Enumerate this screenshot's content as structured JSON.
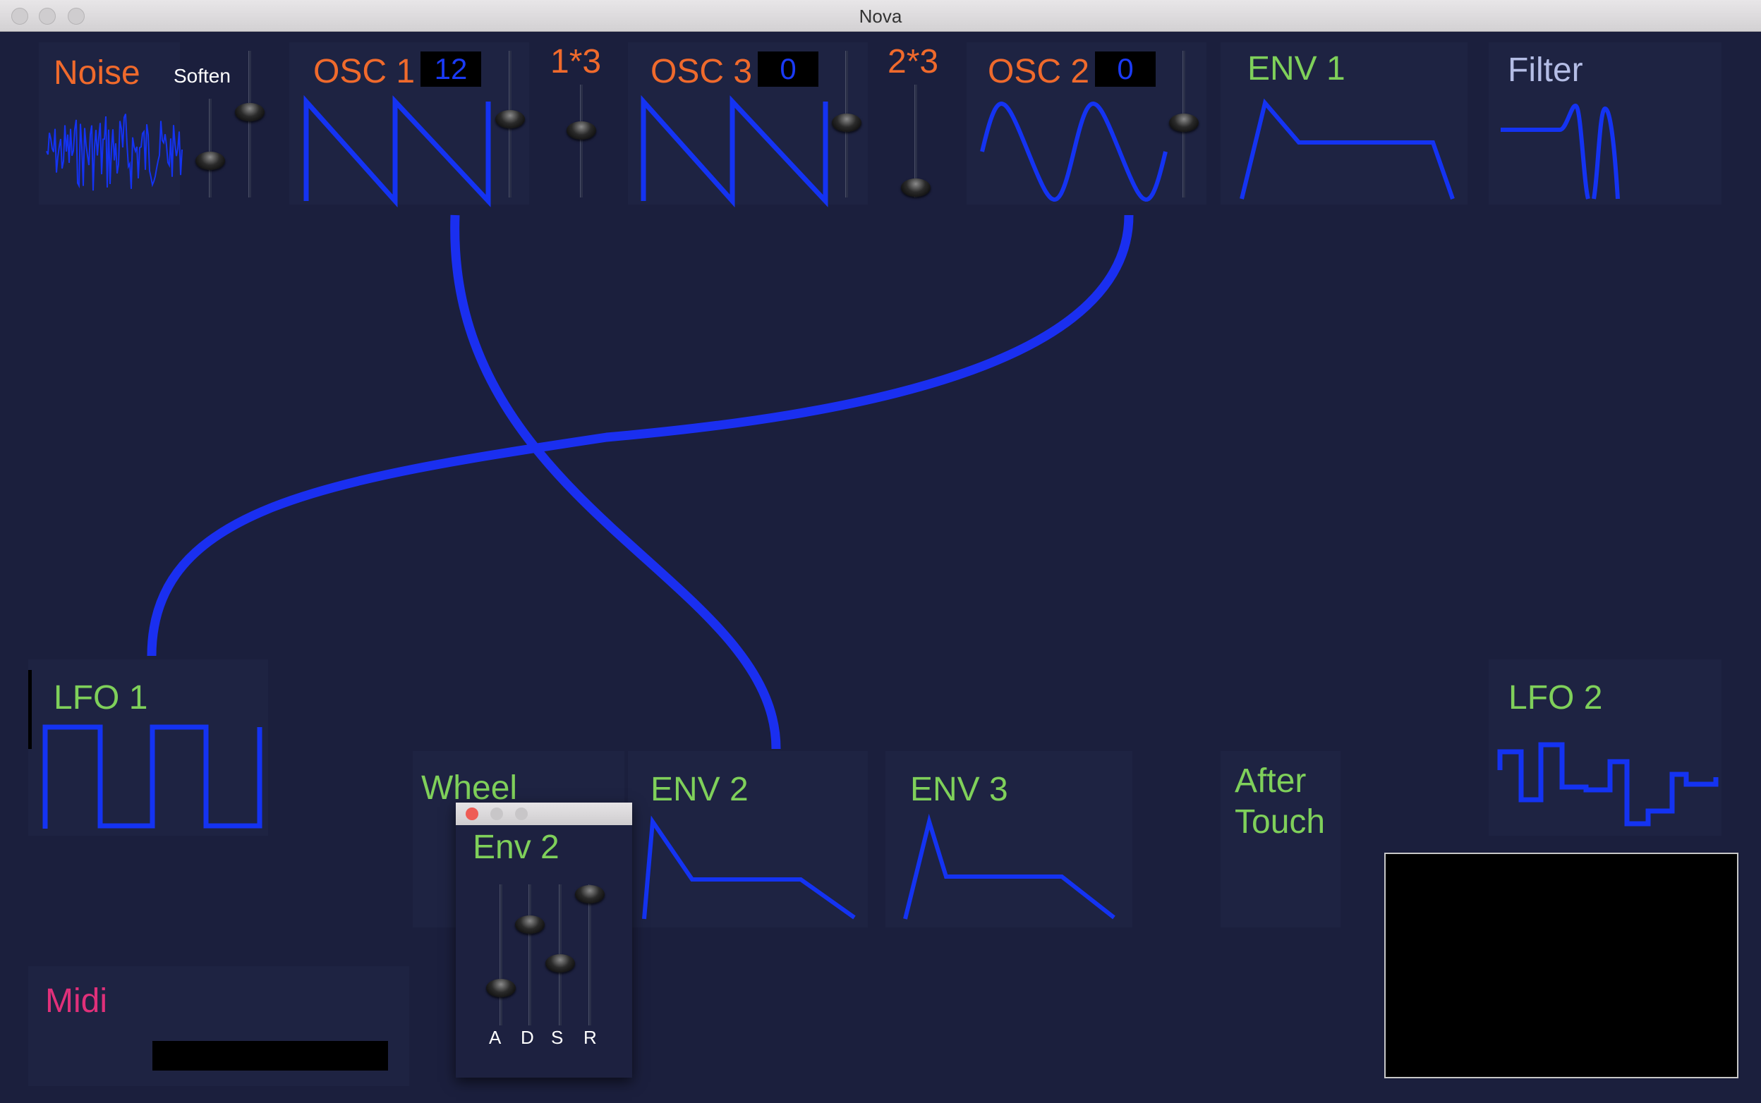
{
  "window": {
    "title": "Nova"
  },
  "noise": {
    "label": "Noise",
    "soften_label": "Soften"
  },
  "osc1": {
    "label": "OSC 1",
    "value": "12"
  },
  "mix13": {
    "label": "1*3"
  },
  "osc3": {
    "label": "OSC 3",
    "value": "0"
  },
  "mix23": {
    "label": "2*3"
  },
  "osc2": {
    "label": "OSC 2",
    "value": "0"
  },
  "env1": {
    "label": "ENV 1"
  },
  "filter": {
    "label": "Filter"
  },
  "lfo1": {
    "label": "LFO 1"
  },
  "wheel": {
    "label": "Wheel"
  },
  "env2": {
    "label": "ENV 2"
  },
  "env3": {
    "label": "ENV 3"
  },
  "aftertouch": {
    "label_line1": "After",
    "label_line2": "Touch"
  },
  "lfo2": {
    "label": "LFO 2"
  },
  "midi": {
    "label": "Midi"
  },
  "env2_editor": {
    "title": "Env 2",
    "sliders": [
      "A",
      "D",
      "S",
      "R"
    ]
  },
  "colors": {
    "background": "#1b1f3d",
    "waveform": "#1433f2",
    "module_title_osc": "#f06a2c",
    "module_title_mod": "#7fd05a",
    "filter_title": "#b4bde6",
    "midi_title": "#e0307a"
  }
}
